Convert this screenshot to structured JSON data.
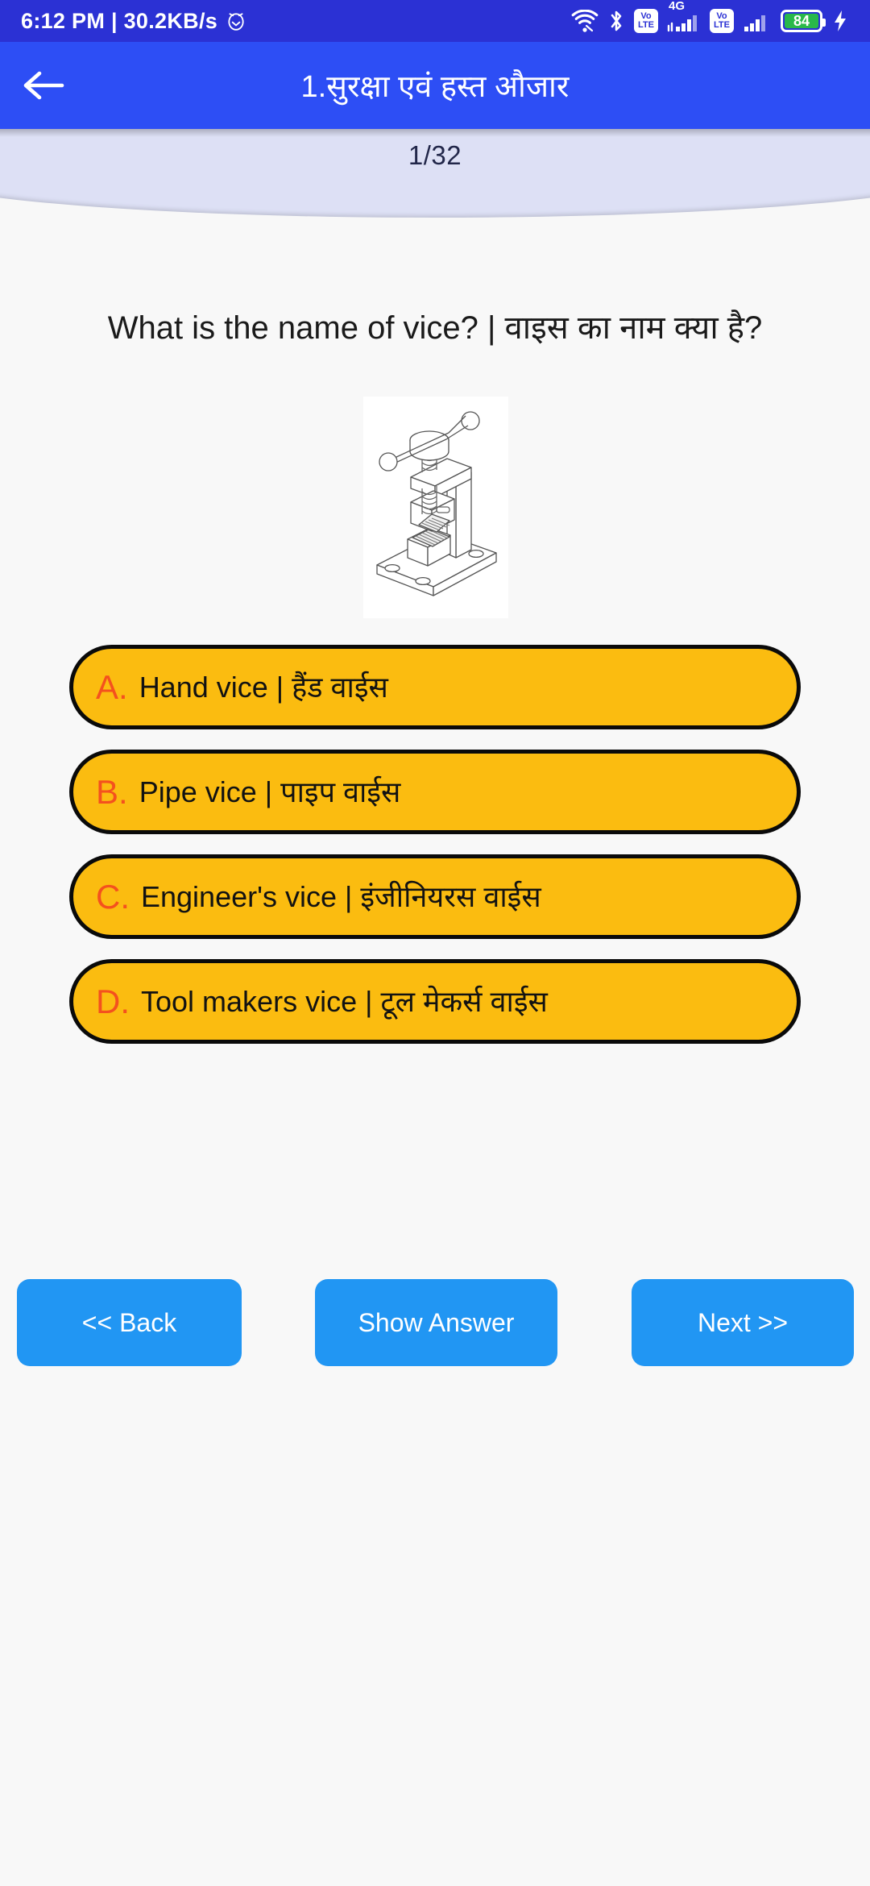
{
  "status_bar": {
    "time": "6:12 PM",
    "separator": "|",
    "network_speed": "30.2KB/s",
    "time_line": "6:12 PM | 30.2KB/s",
    "alarm_icon": "alarm-clock-icon",
    "wifi_icon": "wifi-icon",
    "bluetooth_icon": "bluetooth-icon",
    "volte_label_top": "Vo",
    "volte_label_bottom": "LTE",
    "network_type": "4G",
    "battery_percent": "84",
    "charging_icon": "charging-bolt-icon",
    "bg_color": "#2b31d4"
  },
  "app_bar": {
    "back_icon": "arrow-left-icon",
    "title": "1.सुरक्षा एवं हस्त औजार",
    "bg_color": "#2d4ef5"
  },
  "progress": {
    "counter": "1/32",
    "current": 1,
    "total": 32,
    "band_color": "#dde0f5"
  },
  "question": {
    "text": "What is the name of vice? | वाइस का नाम क्या है?",
    "image_alt": "pipe-vice-line-drawing"
  },
  "options": [
    {
      "letter": "A.",
      "text": "Hand vice | हैंड वाईस"
    },
    {
      "letter": "B.",
      "text": "Pipe vice | पाइप वाईस"
    },
    {
      "letter": "C.",
      "text": "Engineer's vice | इंजीनियरस वाईस"
    },
    {
      "letter": "D.",
      "text": "Tool makers vice | टूल मेकर्स वाईस"
    }
  ],
  "option_style": {
    "fill_color": "#fbbc10",
    "border_color": "#0a0a0a",
    "letter_color": "#f4511e",
    "text_color": "#121212"
  },
  "nav": {
    "back_label": "<< Back",
    "show_answer_label": "Show Answer",
    "next_label": "Next >>",
    "button_color": "#2196f3"
  }
}
